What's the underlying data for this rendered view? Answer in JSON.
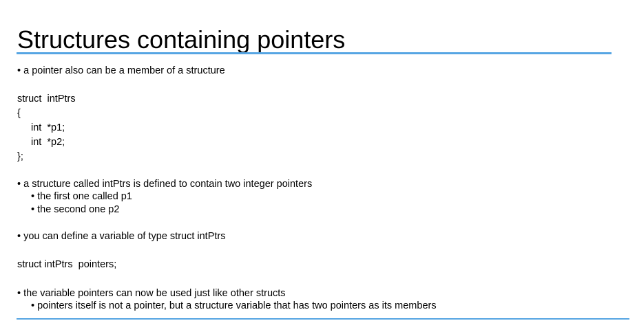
{
  "title": "Structures containing pointers",
  "accent_color": "#56a5e3",
  "bullet_1": "• a pointer also can be a member of a structure",
  "code_struct": {
    "line_1": "struct  intPtrs",
    "line_2": "{",
    "line_3": "int  *p1;",
    "line_4": "int  *p2;",
    "line_5": "};"
  },
  "bullet_2": {
    "text": "• a structure called intPtrs is defined to contain two integer pointers",
    "sub_1": "• the first one called p1",
    "sub_2": "• the second one p2"
  },
  "bullet_3": "• you can define a variable of type struct intPtrs",
  "code_decl": "struct intPtrs  pointers;",
  "bullet_4": {
    "text": "• the variable pointers can now be used just like other structs",
    "sub_1": "• pointers itself is not a pointer, but a structure variable that has two pointers as its members"
  }
}
